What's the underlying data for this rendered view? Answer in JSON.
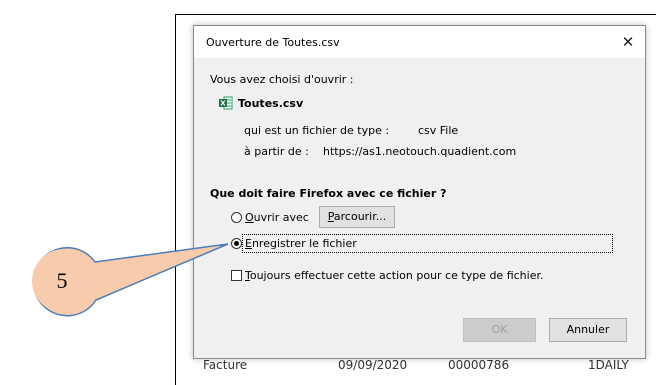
{
  "background": {
    "row_cells": [
      "Facture",
      "09/09/2020",
      "00000786",
      "1DAILY"
    ]
  },
  "dialog": {
    "title": "Ouverture de Toutes.csv",
    "close_symbol": "✕",
    "intro": "Vous avez choisi d'ouvrir :",
    "file_icon": "excel-csv-icon",
    "file_name": "Toutes.csv",
    "type_label": "qui est un fichier de type :",
    "type_value": "csv File",
    "source_label": "à partir de :",
    "source_value": "https://as1.neotouch.quadient.com",
    "question": "Que doit faire Firefox avec ce fichier ?",
    "open_with": {
      "accesskey": "O",
      "rest": "uvrir avec",
      "selected": false
    },
    "browse": {
      "accesskey": "P",
      "rest": "arcourir..."
    },
    "save_file": {
      "accesskey": "E",
      "rest": "nregistrer le fichier",
      "selected": true
    },
    "always": {
      "accesskey": "T",
      "rest": "oujours effectuer cette action pour ce type de fichier.",
      "checked": false
    },
    "ok_label": "OK",
    "cancel_label": "Annuler"
  },
  "callout": {
    "number": "5",
    "fill_color": "#f8cbad",
    "stroke_color": "#4a7ebb"
  }
}
